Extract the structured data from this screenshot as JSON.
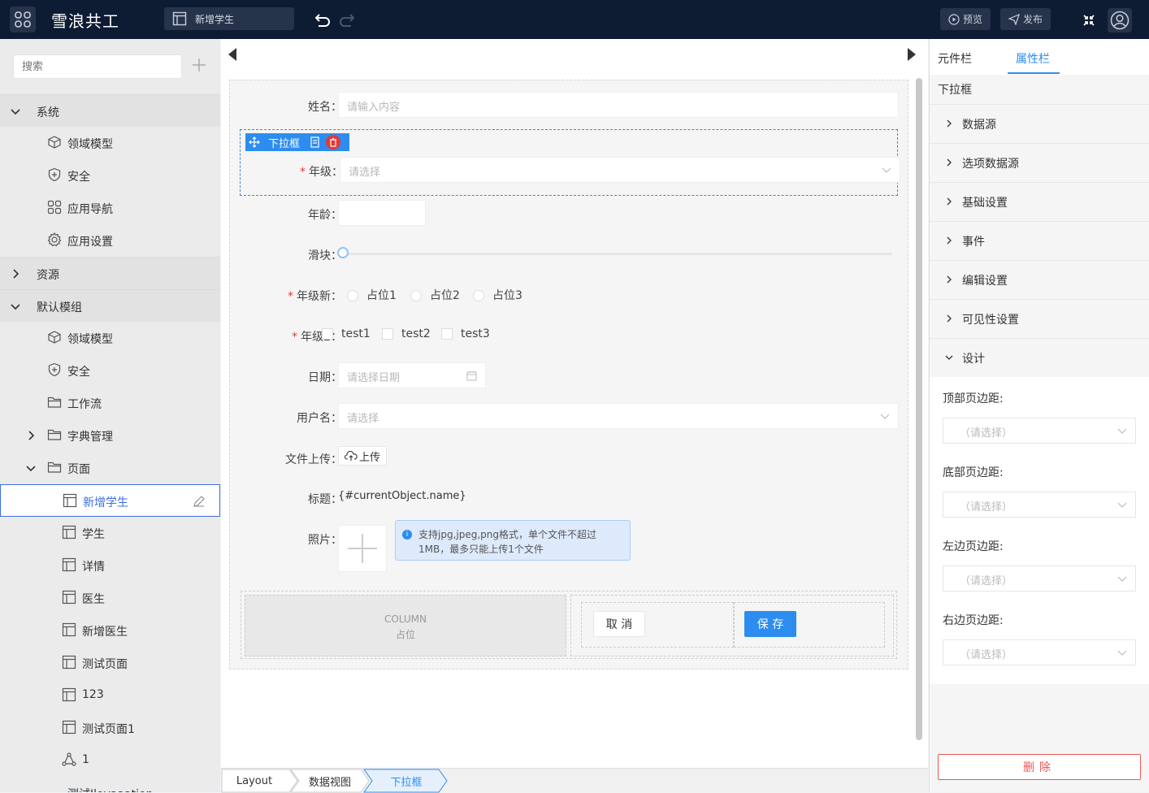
{
  "topbar": {
    "app_title": "雪浪共工",
    "page_tab": "新增学生",
    "preview_label": "预览",
    "publish_label": "发布"
  },
  "sidebar": {
    "search_placeholder": "搜索",
    "tree": [
      {
        "label": "系统",
        "type": "group",
        "expanded": true
      },
      {
        "label": "领域模型",
        "icon": "cube-icon"
      },
      {
        "label": "安全",
        "icon": "shield-icon"
      },
      {
        "label": "应用导航",
        "icon": "grid-icon"
      },
      {
        "label": "应用设置",
        "icon": "gear-icon"
      },
      {
        "label": "资源",
        "type": "group",
        "expanded": false
      },
      {
        "label": "默认模组",
        "type": "group",
        "expanded": true
      },
      {
        "label": "领域模型",
        "icon": "cube-icon"
      },
      {
        "label": "安全",
        "icon": "shield-icon"
      },
      {
        "label": "工作流",
        "icon": "folder-icon"
      },
      {
        "label": "字典管理",
        "icon": "folder-icon"
      },
      {
        "label": "页面",
        "icon": "folder-icon"
      },
      {
        "label": "新增学生",
        "icon": "page-icon",
        "selected": true
      },
      {
        "label": "学生",
        "icon": "page-icon"
      },
      {
        "label": "详情",
        "icon": "page-icon"
      },
      {
        "label": "医生",
        "icon": "page-icon"
      },
      {
        "label": "新增医生",
        "icon": "page-icon"
      },
      {
        "label": "测试页面",
        "icon": "page-icon"
      },
      {
        "label": "123",
        "icon": "page-icon"
      },
      {
        "label": "测试页面1",
        "icon": "page-icon"
      },
      {
        "label": "1",
        "icon": "flow-icon"
      }
    ],
    "partial_last": "测试Ilovaaation"
  },
  "form": {
    "name_label": "姓名：",
    "name_placeholder": "请输入内容",
    "selected_toolbar_label": "下拉框",
    "grade_label": "年级：",
    "grade_placeholder": "请选择",
    "age_label": "年龄：",
    "slider_label": "滑块：",
    "grade_new_label": "年级新：",
    "radio_options": [
      "占位1",
      "占位2",
      "占位3"
    ],
    "grade2_label": "年级2：",
    "check_options": [
      "test1",
      "test2",
      "test3"
    ],
    "date_label": "日期：",
    "date_placeholder": "请选择日期",
    "username_label": "用户名：",
    "username_placeholder": "请选择",
    "upload_label": "文件上传：",
    "upload_button": "上传",
    "title_label": "标题：",
    "title_value": "{#currentObject.name}",
    "photo_label": "照片：",
    "photo_tip": "支持jpg,jpeg,png格式，单个文件不超过1MB，最多只能上传1个文件",
    "column_title": "COLUMN",
    "column_sub": "占位",
    "cancel_button": "取 消",
    "save_button": "保 存"
  },
  "breadcrumb": [
    "Layout",
    "数据视图",
    "下拉框"
  ],
  "right_panel": {
    "tab_components": "元件栏",
    "tab_properties": "属性栏",
    "current_component": "下拉框",
    "sections": [
      "数据源",
      "选项数据源",
      "基础设置",
      "事件",
      "编辑设置",
      "可见性设置"
    ],
    "design_section": "设计",
    "design_fields": [
      {
        "label": "顶部页边距:",
        "placeholder": "（请选择）"
      },
      {
        "label": "底部页边距:",
        "placeholder": "（请选择）"
      },
      {
        "label": "左边页边距:",
        "placeholder": "（请选择）"
      },
      {
        "label": "右边页边距:",
        "placeholder": "（请选择）"
      }
    ],
    "delete_button": "删除"
  },
  "colors": {
    "topbar": "#0d1b33",
    "accent": "#2d8cf0",
    "danger": "#e53935"
  }
}
